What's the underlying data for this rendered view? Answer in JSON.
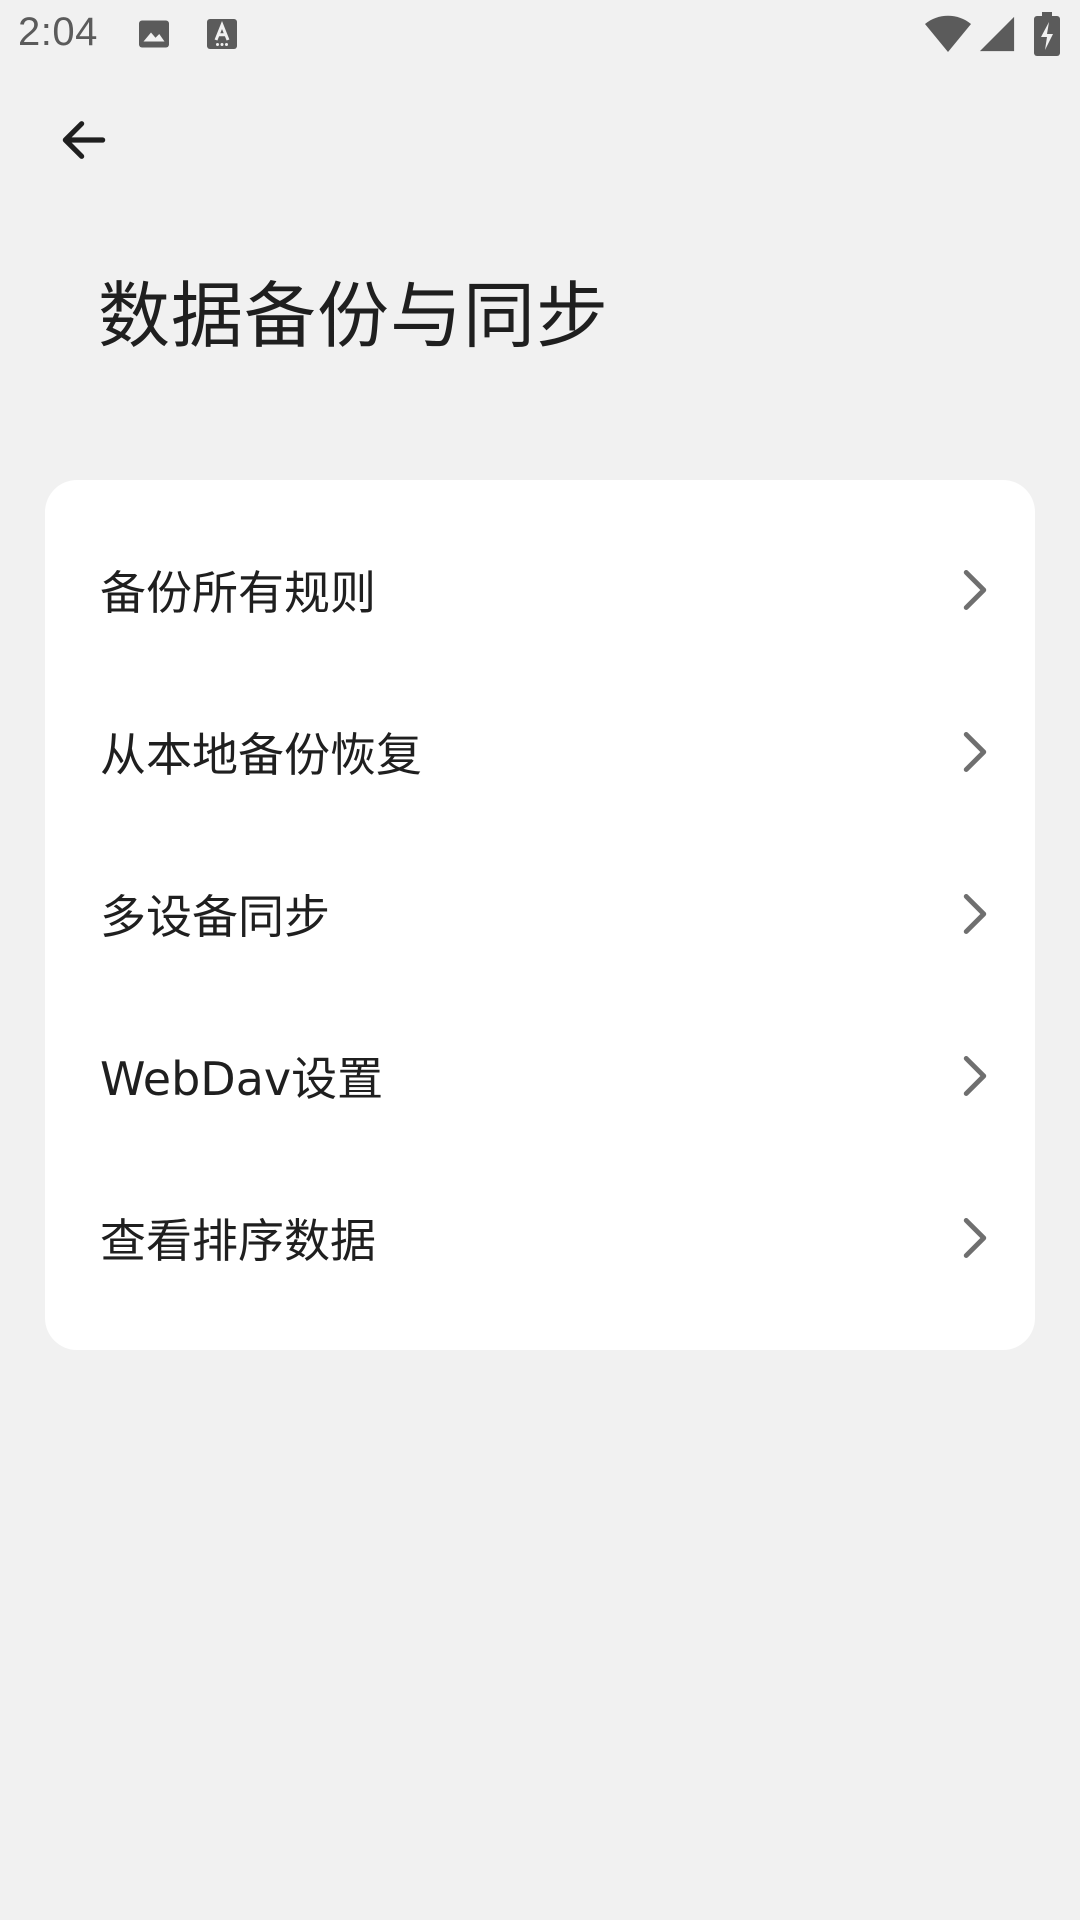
{
  "status_bar": {
    "time": "2:04",
    "icons": [
      "image-icon",
      "a-icon",
      "wifi-icon",
      "signal-icon",
      "battery-charging-icon"
    ]
  },
  "header": {
    "back_icon": "arrow-left-icon",
    "title": "数据备份与同步"
  },
  "menu": {
    "items": [
      {
        "label": "备份所有规则",
        "icon": "chevron-right-icon"
      },
      {
        "label": "从本地备份恢复",
        "icon": "chevron-right-icon"
      },
      {
        "label": "多设备同步",
        "icon": "chevron-right-icon"
      },
      {
        "label": "WebDav设置",
        "icon": "chevron-right-icon"
      },
      {
        "label": "查看排序数据",
        "icon": "chevron-right-icon"
      }
    ]
  },
  "colors": {
    "background": "#f1f1f1",
    "card": "#ffffff",
    "text": "#1f1f1f",
    "chevron": "#6f6f6f"
  }
}
